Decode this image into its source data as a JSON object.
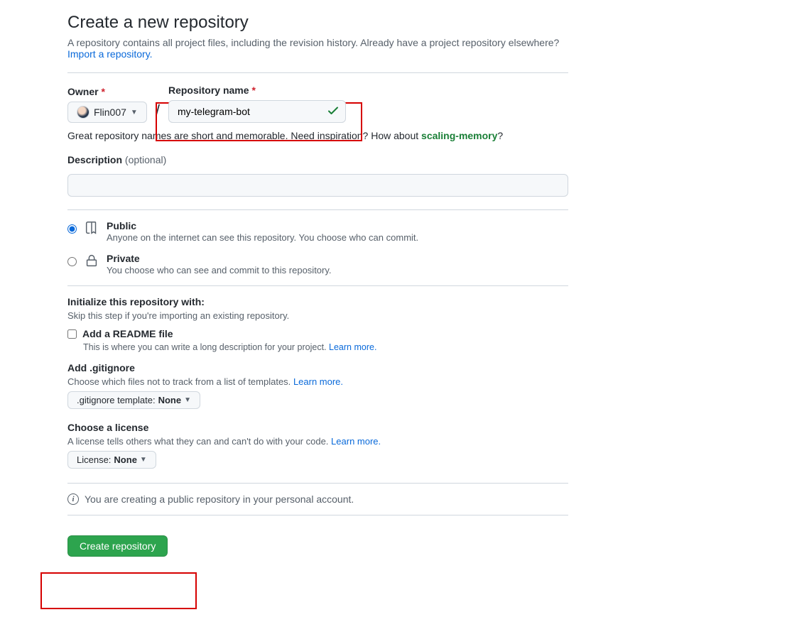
{
  "header": {
    "title": "Create a new repository",
    "desc": "A repository contains all project files, including the revision history. Already have a project repository elsewhere?",
    "import_link": "Import a repository."
  },
  "owner": {
    "label": "Owner",
    "username": "Flin007"
  },
  "repo": {
    "label": "Repository name",
    "name": "my-telegram-bot",
    "hint_prefix": "Great repository names are short and memorable. Need inspiration? How about ",
    "hint_suggestion": "scaling-memory",
    "hint_suffix": "?"
  },
  "description": {
    "label": "Description",
    "optional": "(optional)",
    "value": ""
  },
  "visibility": {
    "public": {
      "title": "Public",
      "desc": "Anyone on the internet can see this repository. You choose who can commit."
    },
    "private": {
      "title": "Private",
      "desc": "You choose who can see and commit to this repository."
    }
  },
  "init": {
    "title": "Initialize this repository with:",
    "skip": "Skip this step if you're importing an existing repository.",
    "readme": {
      "label": "Add a README file",
      "desc": "This is where you can write a long description for your project.",
      "learn": "Learn more."
    },
    "gitignore": {
      "title": "Add .gitignore",
      "desc": "Choose which files not to track from a list of templates.",
      "learn": "Learn more.",
      "select_prefix": ".gitignore template: ",
      "select_value": "None"
    },
    "license": {
      "title": "Choose a license",
      "desc": "A license tells others what they can and can't do with your code.",
      "learn": "Learn more.",
      "select_prefix": "License: ",
      "select_value": "None"
    }
  },
  "info": "You are creating a public repository in your personal account.",
  "submit": "Create repository"
}
